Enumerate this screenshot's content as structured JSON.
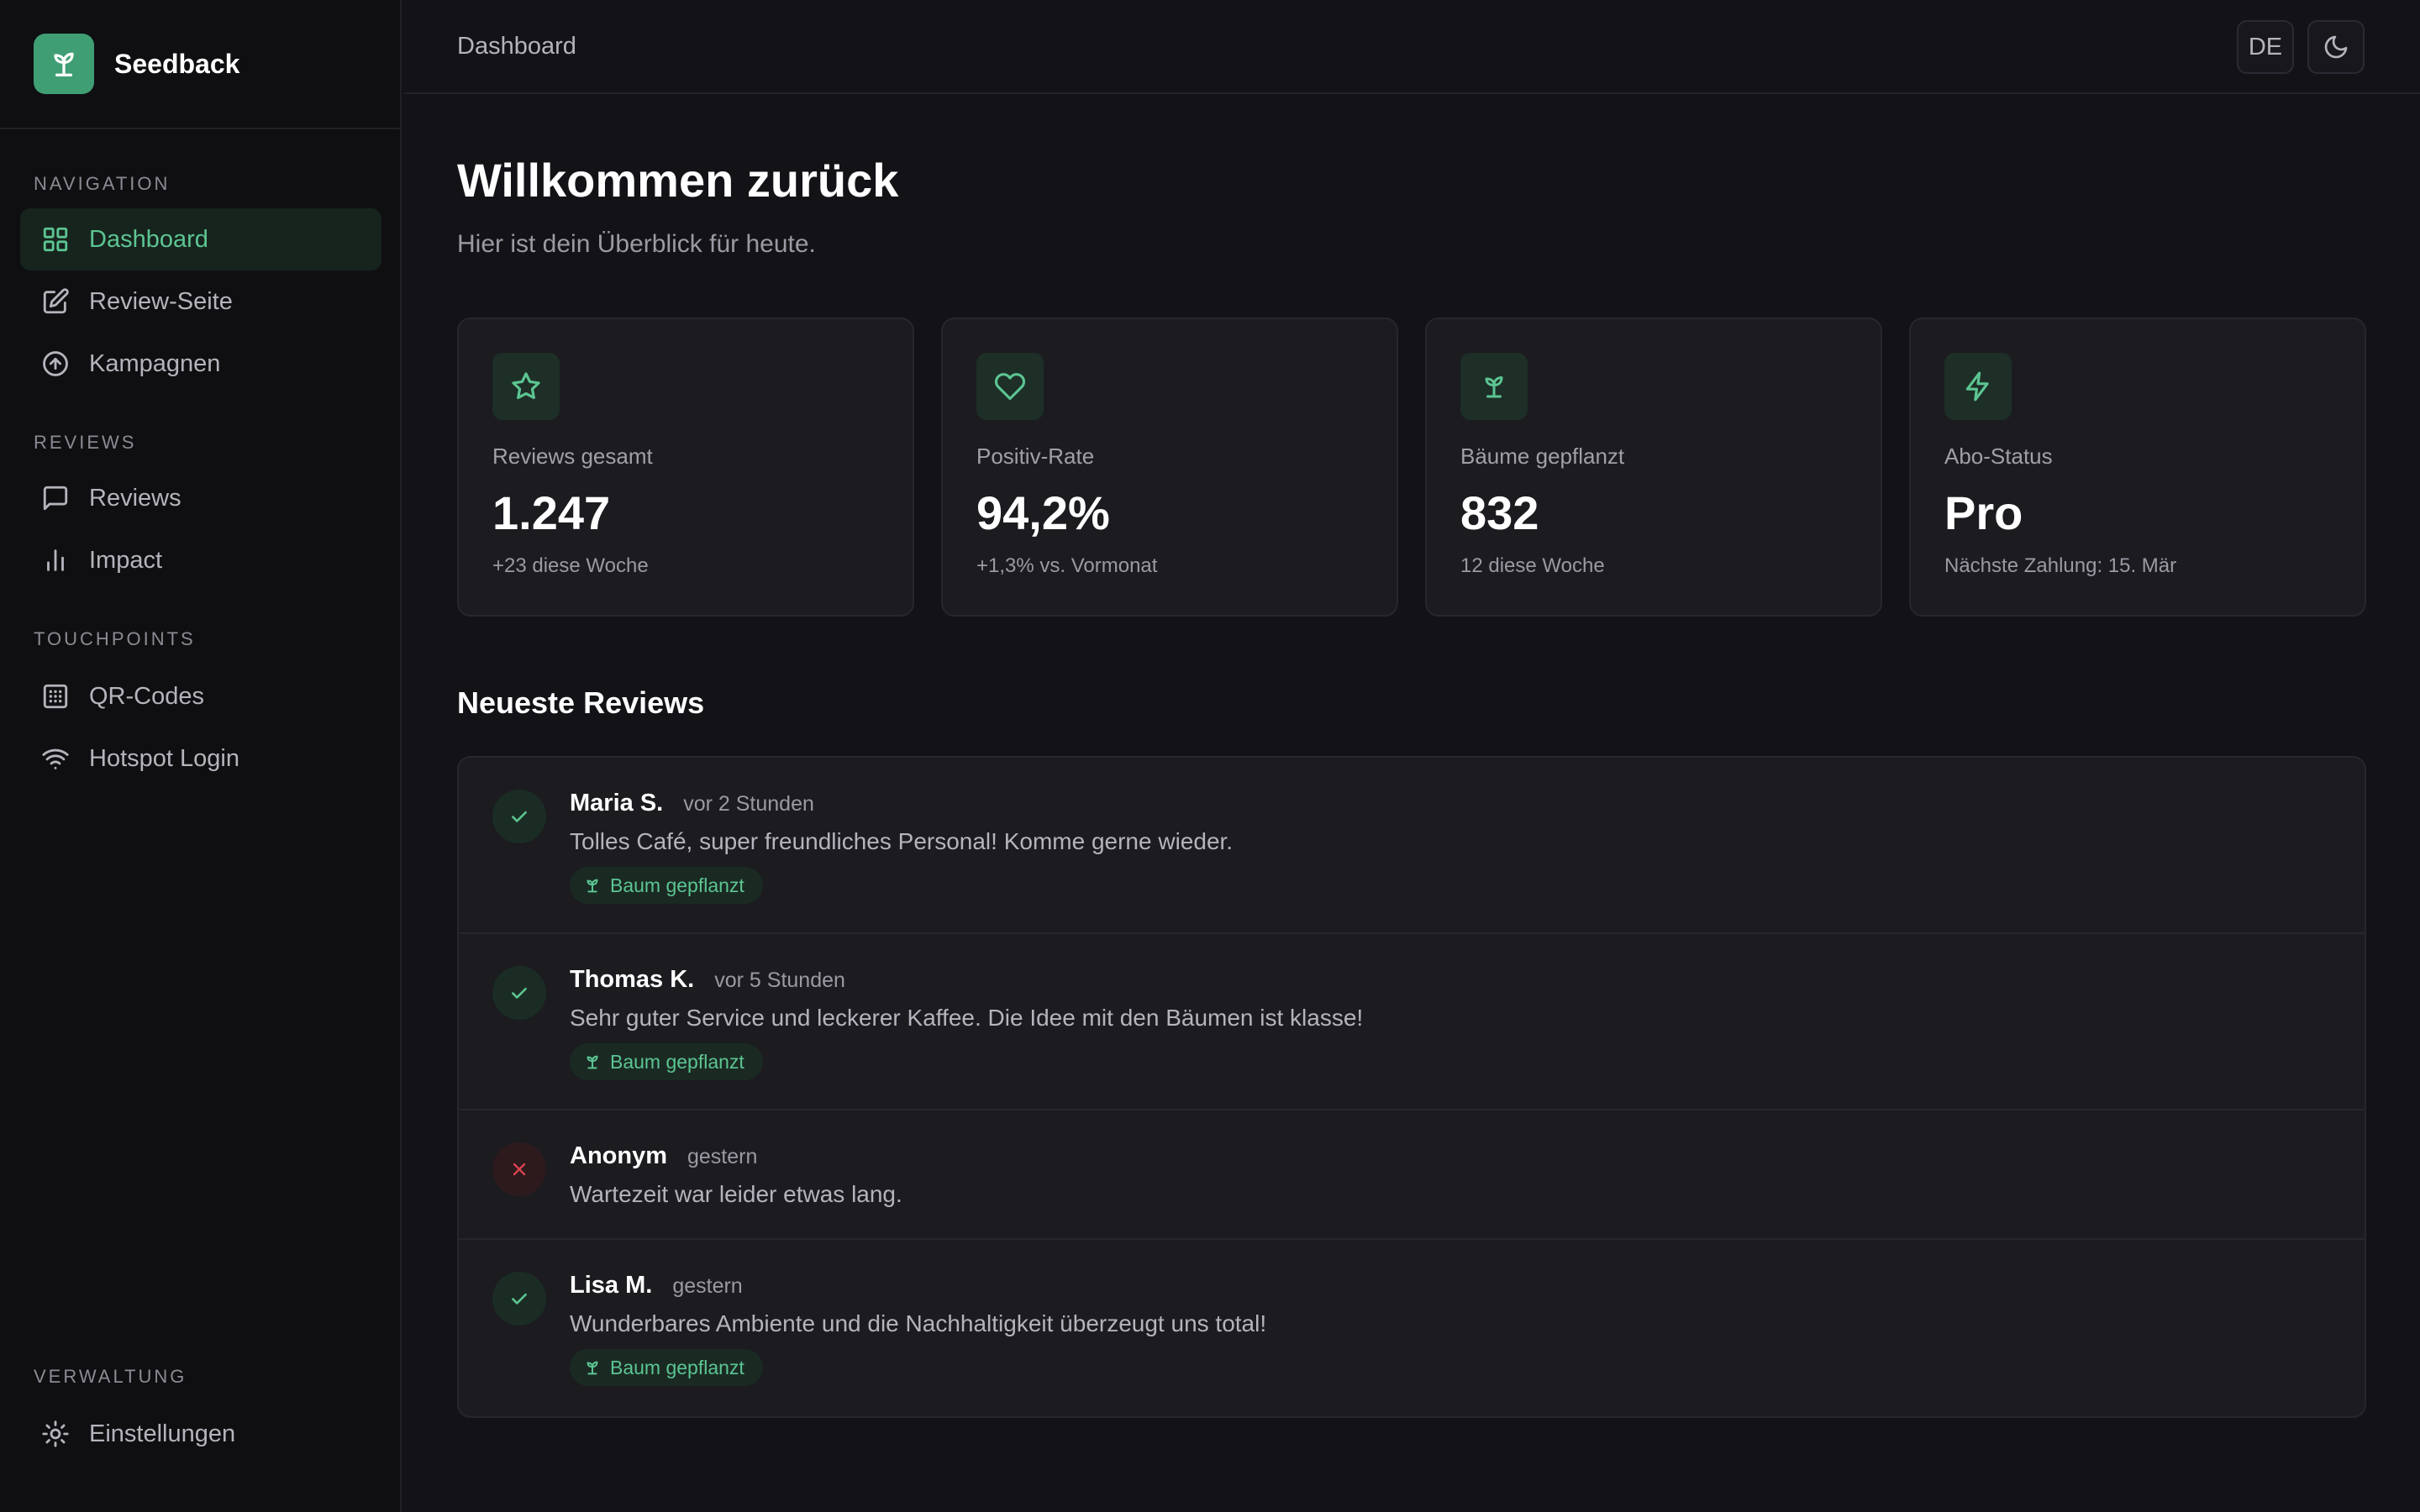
{
  "app": {
    "name": "Seedback"
  },
  "sidebar": {
    "sections": [
      {
        "label": "NAVIGATION",
        "items": [
          {
            "label": "Dashboard",
            "icon": "grid-icon",
            "active": true
          },
          {
            "label": "Review-Seite",
            "icon": "edit-icon"
          },
          {
            "label": "Kampagnen",
            "icon": "arrow-up-circle-icon"
          }
        ]
      },
      {
        "label": "REVIEWS",
        "items": [
          {
            "label": "Reviews",
            "icon": "message-icon"
          },
          {
            "label": "Impact",
            "icon": "bar-chart-icon"
          }
        ]
      },
      {
        "label": "TOUCHPOINTS",
        "items": [
          {
            "label": "QR-Codes",
            "icon": "qr-code-icon"
          },
          {
            "label": "Hotspot Login",
            "icon": "wifi-icon"
          }
        ]
      },
      {
        "label": "VERWALTUNG",
        "items": [
          {
            "label": "Einstellungen",
            "icon": "settings-icon"
          }
        ]
      }
    ]
  },
  "topbar": {
    "title": "Dashboard",
    "language": "DE",
    "theme_icon": "moon-icon"
  },
  "main": {
    "title": "Willkommen zurück",
    "subtitle": "Hier ist dein Überblick für heute.",
    "stats": [
      {
        "label": "Reviews gesamt",
        "value": "1.247",
        "note": "+23 diese Woche",
        "icon": "star-icon"
      },
      {
        "label": "Positiv-Rate",
        "value": "94,2%",
        "note": "+1,3% vs. Vormonat",
        "icon": "heart-icon"
      },
      {
        "label": "Bäume gepflanzt",
        "value": "832",
        "note": "12 diese Woche",
        "icon": "sprout-icon"
      },
      {
        "label": "Abo-Status",
        "value": "Pro",
        "note": "Nächste Zahlung: 15. Mär",
        "icon": "zap-icon"
      }
    ],
    "recent_title": "Neueste Reviews",
    "reviews": [
      {
        "author": "Maria S.",
        "time": "vor 2 Stunden",
        "text": "Tolles Café, super freundliches Personal! Komme gerne wieder.",
        "positive": true,
        "badge": "Baum gepflanzt"
      },
      {
        "author": "Thomas K.",
        "time": "vor 5 Stunden",
        "text": "Sehr guter Service und leckerer Kaffee. Die Idee mit den Bäumen ist klasse!",
        "positive": true,
        "badge": "Baum gepflanzt"
      },
      {
        "author": "Anonym",
        "time": "gestern",
        "text": "Wartezeit war leider etwas lang.",
        "positive": false,
        "badge": ""
      },
      {
        "author": "Lisa M.",
        "time": "gestern",
        "text": "Wunderbares Ambiente und die Nachhaltigkeit überzeugt uns total!",
        "positive": true,
        "badge": "Baum gepflanzt"
      }
    ]
  },
  "colors": {
    "accent": "#5cc592",
    "brand": "#3f9e74",
    "negative": "#d9434f",
    "background": "#131317"
  }
}
